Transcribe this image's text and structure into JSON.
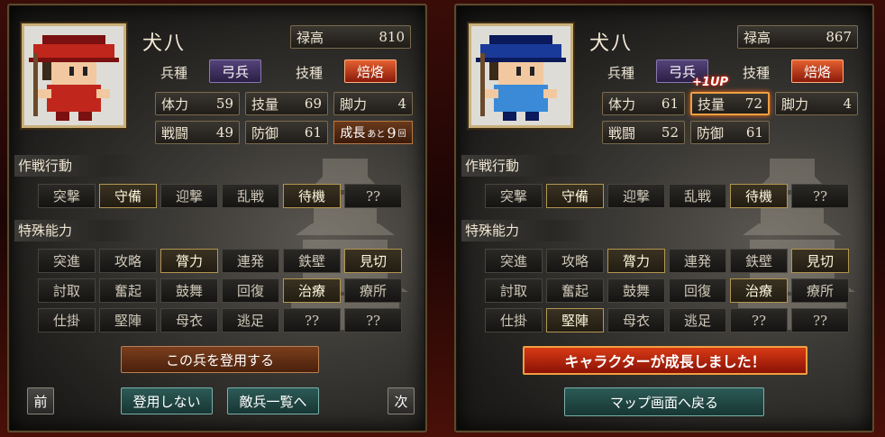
{
  "left": {
    "name": "犬八",
    "stipend_label": "禄高",
    "stipend_value": "810",
    "unit_type_label": "兵種",
    "unit_type_value": "弓兵",
    "skill_label": "技種",
    "skill_value": "焙烙",
    "stats": {
      "hp_label": "体力",
      "hp": "59",
      "skill_label": "技量",
      "skill": "69",
      "speed_label": "脚力",
      "speed": "4",
      "atk_label": "戦闘",
      "atk": "49",
      "def_label": "防御",
      "def": "61"
    },
    "growth": {
      "prefix": "成長",
      "small": "あと",
      "value": "9",
      "unit": "回"
    },
    "tactics_title": "作戦行動",
    "tactics": [
      "突撃",
      "守備",
      "迎撃",
      "乱戦",
      "待機",
      "??"
    ],
    "abilities_title": "特殊能力",
    "abilities": [
      "突進",
      "攻略",
      "膂力",
      "連発",
      "鉄壁",
      "見切",
      "討取",
      "奮起",
      "鼓舞",
      "回復",
      "治療",
      "療所",
      "仕掛",
      "堅陣",
      "母衣",
      "逃足",
      "??",
      "??"
    ],
    "recruit_button": "この兵を登用する",
    "prev_button": "前",
    "decline_button": "登用しない",
    "enemy_list_button": "敵兵一覧へ",
    "next_button": "次"
  },
  "right": {
    "name": "犬八",
    "stipend_label": "禄高",
    "stipend_value": "867",
    "unit_type_label": "兵種",
    "unit_type_value": "弓兵",
    "skill_label": "技種",
    "skill_value": "焙烙",
    "levelup_badge": "+1UP",
    "stats": {
      "hp_label": "体力",
      "hp": "61",
      "skill_label": "技量",
      "skill": "72",
      "speed_label": "脚力",
      "speed": "4",
      "atk_label": "戦闘",
      "atk": "52",
      "def_label": "防御",
      "def": "61"
    },
    "tactics_title": "作戦行動",
    "tactics": [
      "突撃",
      "守備",
      "迎撃",
      "乱戦",
      "待機",
      "??"
    ],
    "abilities_title": "特殊能力",
    "abilities": [
      "突進",
      "攻略",
      "膂力",
      "連発",
      "鉄壁",
      "見切",
      "討取",
      "奮起",
      "鼓舞",
      "回復",
      "治療",
      "療所",
      "仕掛",
      "堅陣",
      "母衣",
      "逃足",
      "??",
      "??"
    ],
    "growth_banner": "キャラクターが成長しました！",
    "return_button": "マップ画面へ戻る"
  },
  "colors": {
    "accent_fire": "#d83a14",
    "highlight_gold": "#b39650",
    "portrait_left": "#c0261c",
    "portrait_right": "#1a3a9a"
  }
}
